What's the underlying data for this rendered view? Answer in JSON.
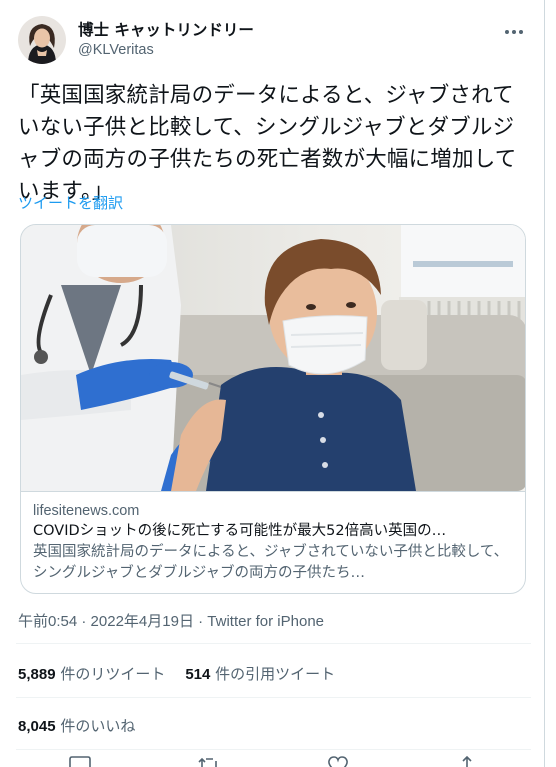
{
  "author": {
    "display_name": "博士 キャットリンドリー",
    "handle": "@KLVeritas"
  },
  "tweet": {
    "text": "「英国国家統計局のデータによると、ジャブされていない子供と比較して、シングルジャブとダブルジャブの両方の子供たちの死亡者数が大幅に増加しています。」",
    "translate_label": "ツイートを翻訳"
  },
  "card": {
    "domain": "lifesitenews.com",
    "title": "COVIDショットの後に死亡する可能性が最大52倍高い英国の…",
    "description": "英国国家統計局のデータによると、ジャブされていない子供と比較して、シングルジャブとダブルジャブの両方の子供たち…"
  },
  "meta": {
    "time": "午前0:54",
    "date": "2022年4月19日",
    "source": "Twitter for iPhone",
    "separator": " · "
  },
  "stats": {
    "retweets_count": "5,889",
    "retweets_label": " 件のリツイート",
    "quotes_count": "514",
    "quotes_label": " 件の引用ツイート",
    "likes_count": "8,045",
    "likes_label": " 件のいいね"
  },
  "icons": {
    "more": "more-dots-icon",
    "reply": "reply-icon",
    "retweet": "retweet-icon",
    "like": "heart-icon",
    "share": "share-icon"
  },
  "colors": {
    "link": "#1d9bf0",
    "secondary_text": "#536471",
    "border": "#cfd9de",
    "glove": "#2f6fd0",
    "shirt": "#24406e"
  }
}
